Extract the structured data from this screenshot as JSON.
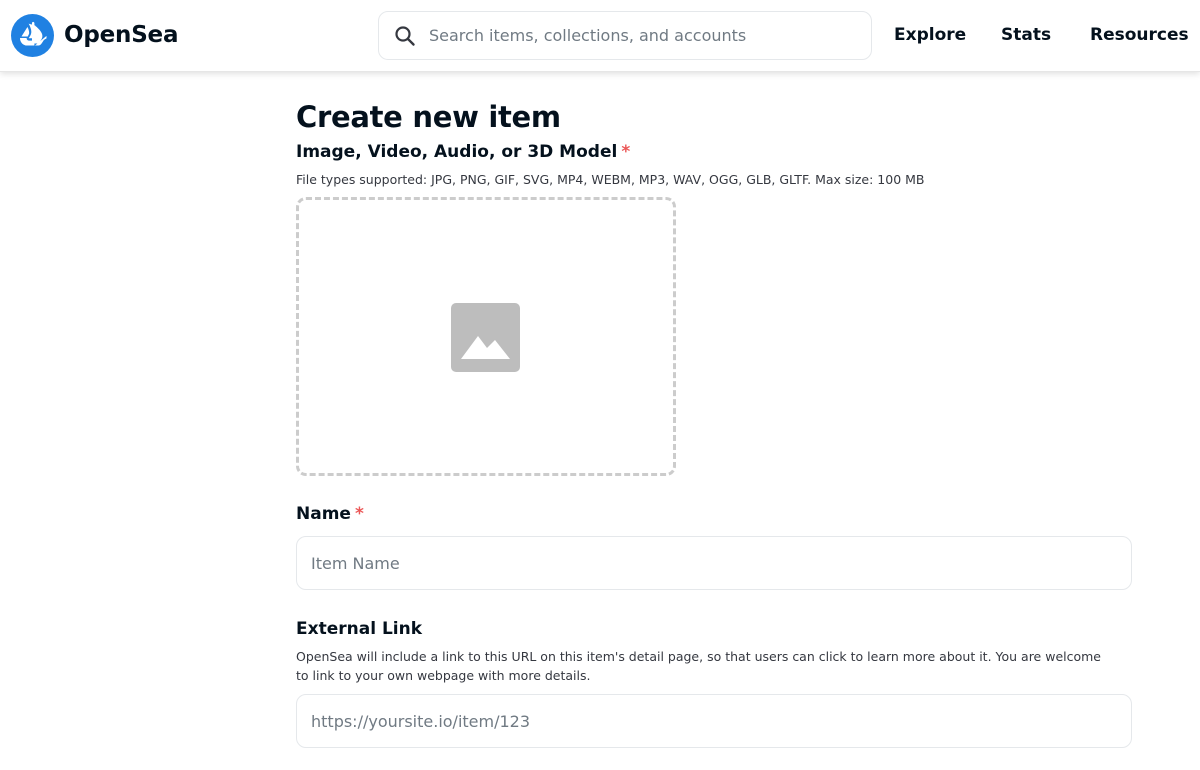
{
  "header": {
    "brand": "OpenSea",
    "logo_icon": "opensea-boat-icon",
    "search": {
      "icon": "search-icon",
      "placeholder": "Search items, collections, and accounts",
      "value": ""
    },
    "nav": [
      "Explore",
      "Stats",
      "Resources"
    ]
  },
  "page": {
    "title": "Create new item"
  },
  "media_field": {
    "label": "Image, Video, Audio, or 3D Model",
    "required_marker": "*",
    "helper": "File types supported: JPG, PNG, GIF, SVG, MP4, WEBM, MP3, WAV, OGG, GLB, GLTF. Max size: 100 MB",
    "placeholder_icon": "image-icon"
  },
  "name_field": {
    "label": "Name",
    "required_marker": "*",
    "placeholder": "Item Name",
    "value": ""
  },
  "external_link_field": {
    "label": "External Link",
    "helper_line1": "OpenSea will include a link to this URL on this item's detail page, so that users can click to learn more about it. You are welcome",
    "helper_line2": "to link to your own webpage with more details.",
    "placeholder": "https://yoursite.io/item/123",
    "value": ""
  },
  "colors": {
    "brand_blue": "#2081e2",
    "required_red": "#eb5757",
    "text_primary": "#04111d",
    "placeholder_gray": "#707a83"
  }
}
